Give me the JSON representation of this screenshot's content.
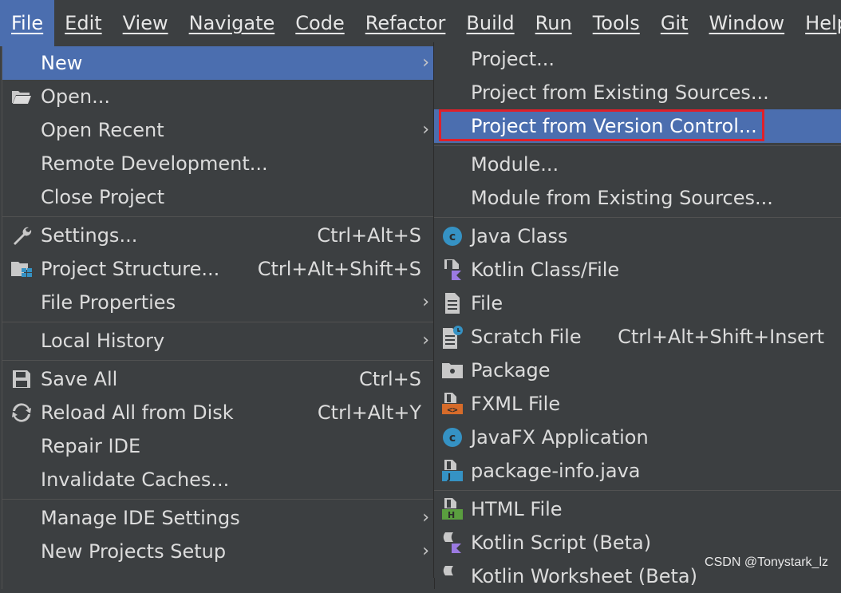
{
  "menubar": {
    "items": [
      "File",
      "Edit",
      "View",
      "Navigate",
      "Code",
      "Refactor",
      "Build",
      "Run",
      "Tools",
      "Git",
      "Window",
      "Help"
    ]
  },
  "file_menu": {
    "new": "New",
    "open": "Open...",
    "open_recent": "Open Recent",
    "remote_dev": "Remote Development...",
    "close_project": "Close Project",
    "settings": "Settings...",
    "settings_sc": "Ctrl+Alt+S",
    "project_structure": "Project Structure...",
    "project_structure_sc": "Ctrl+Alt+Shift+S",
    "file_properties": "File Properties",
    "local_history": "Local History",
    "save_all": "Save All",
    "save_all_sc": "Ctrl+S",
    "reload": "Reload All from Disk",
    "reload_sc": "Ctrl+Alt+Y",
    "repair": "Repair IDE",
    "invalidate": "Invalidate Caches...",
    "manage_ide": "Manage IDE Settings",
    "new_projects_setup": "New Projects Setup"
  },
  "new_submenu": {
    "project": "Project...",
    "project_existing": "Project from Existing Sources...",
    "project_vcs": "Project from Version Control...",
    "module": "Module...",
    "module_existing": "Module from Existing Sources...",
    "java_class": "Java Class",
    "kotlin_class": "Kotlin Class/File",
    "file": "File",
    "scratch": "Scratch File",
    "scratch_sc": "Ctrl+Alt+Shift+Insert",
    "package": "Package",
    "fxml": "FXML File",
    "javafx": "JavaFX Application",
    "package_info": "package-info.java",
    "html": "HTML File",
    "kotlin_script": "Kotlin Script (Beta)",
    "kotlin_worksheet": "Kotlin Worksheet (Beta)"
  },
  "colors": {
    "highlight": "#4b6eaf",
    "background": "#3c3f41",
    "redbox": "#e0202a"
  },
  "watermark": "CSDN @Tonystark_lz"
}
